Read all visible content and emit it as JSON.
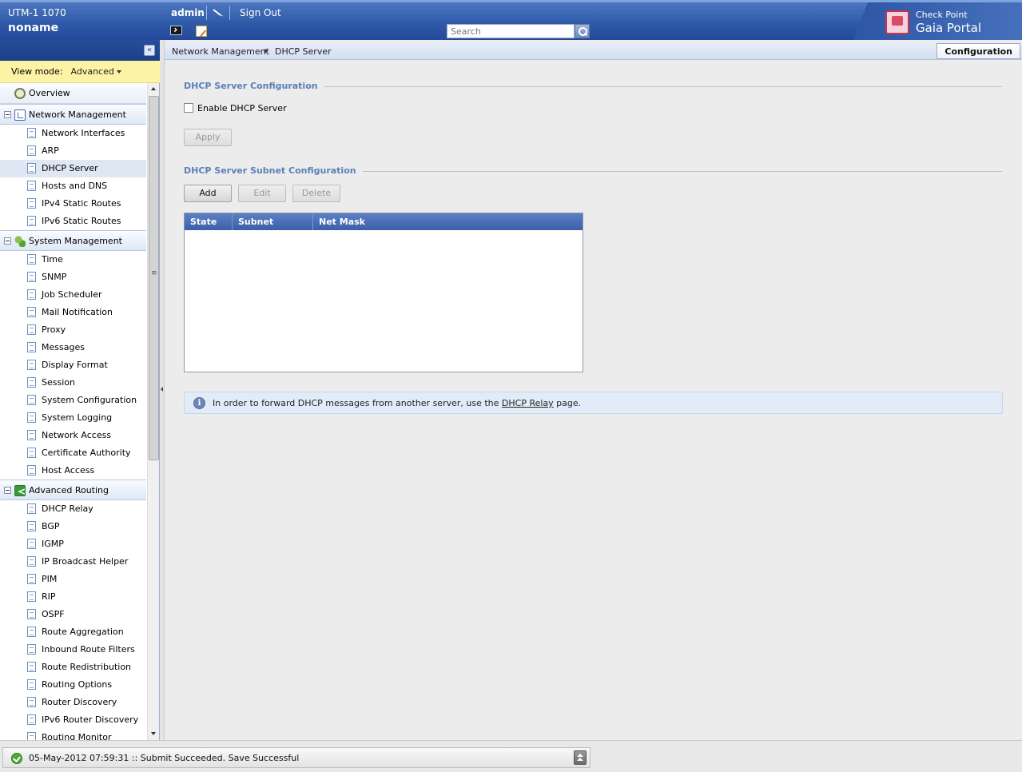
{
  "header": {
    "device_model": "UTM-1 1070",
    "host_name": "noname",
    "user": "admin",
    "sign_out": "Sign Out",
    "search_placeholder": "Search",
    "brand_line1": "Check Point",
    "brand_line2": "Gaia Portal"
  },
  "sidebar": {
    "view_mode_label": "View mode:",
    "view_mode_value": "Advanced",
    "overview": "Overview",
    "categories": [
      {
        "label": "Network Management",
        "icon": "network-management-icon",
        "items": [
          "Network Interfaces",
          "ARP",
          "DHCP Server",
          "Hosts and DNS",
          "IPv4 Static Routes",
          "IPv6 Static Routes"
        ]
      },
      {
        "label": "System Management",
        "icon": "system-management-icon",
        "items": [
          "Time",
          "SNMP",
          "Job Scheduler",
          "Mail Notification",
          "Proxy",
          "Messages",
          "Display Format",
          "Session",
          "System Configuration",
          "System Logging",
          "Network Access",
          "Certificate Authority",
          "Host Access"
        ]
      },
      {
        "label": "Advanced Routing",
        "icon": "advanced-routing-icon",
        "items": [
          "DHCP Relay",
          "BGP",
          "IGMP",
          "IP Broadcast Helper",
          "PIM",
          "RIP",
          "OSPF",
          "Route Aggregation",
          "Inbound Route Filters",
          "Route Redistribution",
          "Routing Options",
          "Router Discovery",
          "IPv6 Router Discovery",
          "Routing Monitor"
        ]
      }
    ],
    "selected_item": "DHCP Server"
  },
  "breadcrumb": {
    "parent": "Network Management",
    "current": "DHCP Server",
    "mode_tab": "Configuration"
  },
  "content": {
    "section1_title": "DHCP Server Configuration",
    "enable_label": "Enable DHCP Server",
    "enable_checked": false,
    "apply_label": "Apply",
    "section2_title": "DHCP Server Subnet Configuration",
    "add_label": "Add",
    "edit_label": "Edit",
    "delete_label": "Delete",
    "table": {
      "columns": [
        "State",
        "Subnet",
        "Net Mask"
      ],
      "rows": []
    },
    "info": {
      "text_before": "In order to forward DHCP messages from another server, use the ",
      "link": "DHCP Relay",
      "text_after": " page."
    }
  },
  "status": {
    "message": "05-May-2012 07:59:31 :: Submit Succeeded. Save Successful"
  }
}
